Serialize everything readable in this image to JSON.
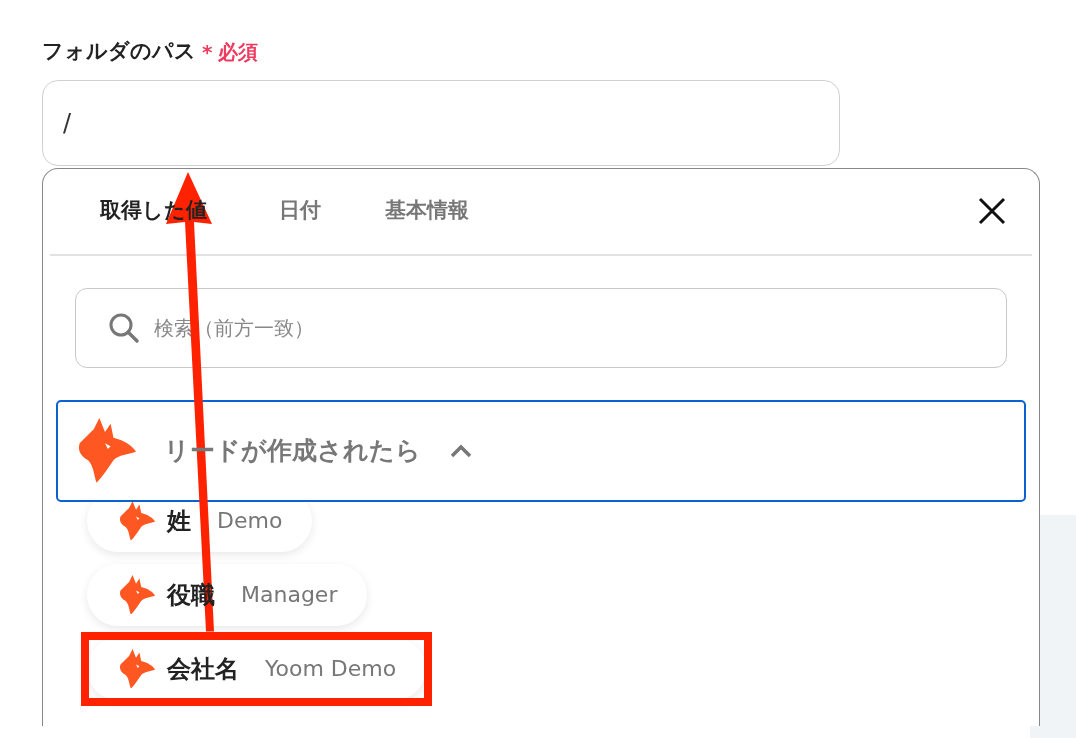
{
  "field": {
    "label": "フォルダのパス",
    "required_mark": "*",
    "required_text": "必須",
    "value": "/"
  },
  "popup": {
    "tabs": [
      {
        "label": "取得した値",
        "selected": true
      },
      {
        "label": "日付",
        "selected": false
      },
      {
        "label": "基本情報",
        "selected": false
      }
    ],
    "search": {
      "placeholder": "検索（前方一致）"
    },
    "group": {
      "title": "リードが作成されたら",
      "expanded": true,
      "items": [
        {
          "name": "姓",
          "value": "Demo",
          "highlighted": false
        },
        {
          "name": "役職",
          "value": "Manager",
          "highlighted": false
        },
        {
          "name": "会社名",
          "value": "Yoom Demo",
          "highlighted": true
        }
      ]
    }
  }
}
